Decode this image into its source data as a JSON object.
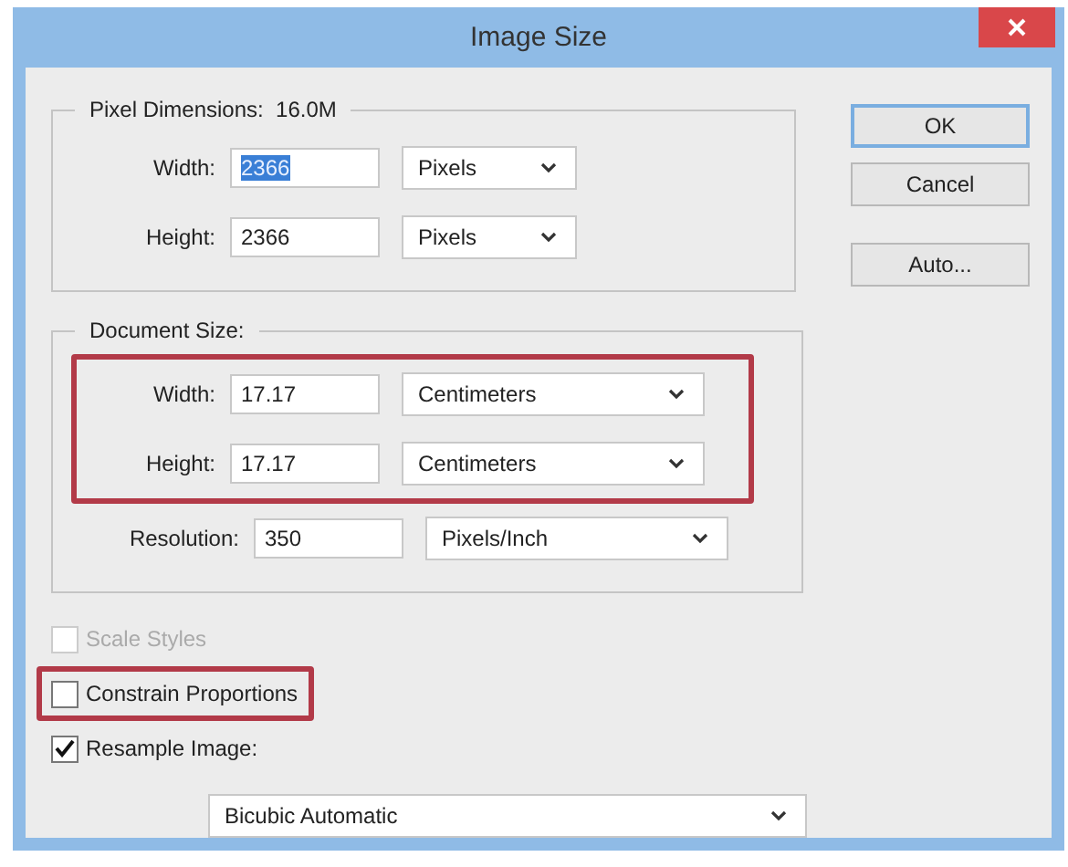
{
  "window": {
    "title": "Image Size"
  },
  "pixel_dimensions": {
    "label": "Pixel Dimensions:",
    "value": "16.0M",
    "rows": [
      {
        "label": "Width:",
        "value": "2366",
        "text_selected": true,
        "unit": "Pixels"
      },
      {
        "label": "Height:",
        "value": "2366",
        "text_selected": false,
        "unit": "Pixels"
      }
    ]
  },
  "document_size": {
    "label": "Document Size:",
    "rows": [
      {
        "label": "Width:",
        "value": "17.17",
        "unit": "Centimeters",
        "highlighted": true
      },
      {
        "label": "Height:",
        "value": "17.17",
        "unit": "Centimeters",
        "highlighted": true
      },
      {
        "label": "Resolution:",
        "value": "350",
        "unit": "Pixels/Inch",
        "highlighted": false
      }
    ]
  },
  "options": [
    {
      "label": "Scale Styles",
      "checked": false,
      "disabled": true,
      "highlighted": false
    },
    {
      "label": "Constrain Proportions",
      "checked": false,
      "disabled": false,
      "highlighted": true
    },
    {
      "label": "Resample Image:",
      "checked": true,
      "disabled": false,
      "highlighted": false
    }
  ],
  "resample_method": "Bicubic Automatic",
  "buttons": [
    {
      "label": "OK",
      "default": true
    },
    {
      "label": "Cancel",
      "default": false
    },
    {
      "label": "Auto...",
      "default": false
    }
  ]
}
